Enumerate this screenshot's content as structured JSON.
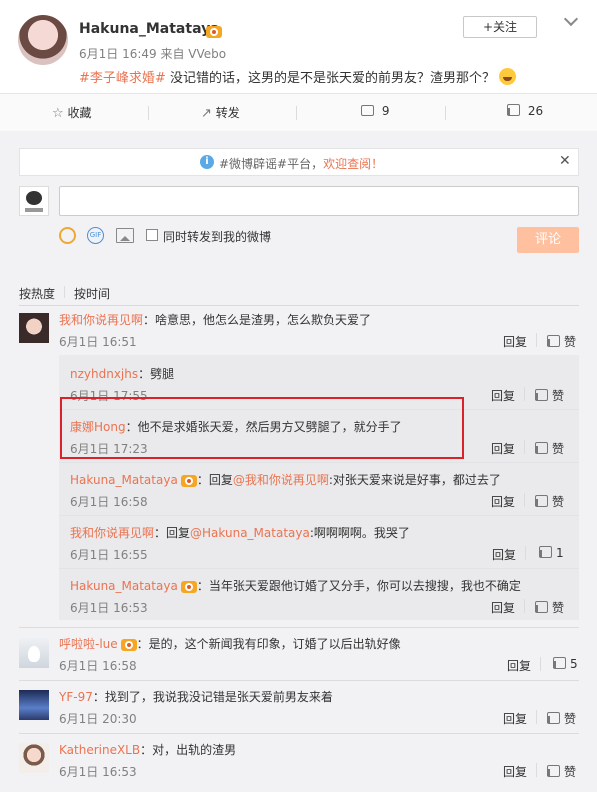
{
  "post": {
    "username": "Hakuna_Matataya",
    "follow_label": "+关注",
    "time": "6月1日 16:49 来自 VVebo",
    "hashtag": "#李子峰求婚#",
    "text": "没记错的话，这男的是不是张天爱的前男友？渣男那个？"
  },
  "actions": {
    "favorite": "收藏",
    "repost": "转发",
    "comment_count": "9",
    "like_count": "26"
  },
  "notice": {
    "text": "#微博辟谣#平台，",
    "link": "欢迎查阅！"
  },
  "composer": {
    "input_value": "",
    "sync_label": "同时转发到我的微博",
    "submit_label": "评论"
  },
  "sort": {
    "hot": "按热度",
    "time": "按时间"
  },
  "labels": {
    "reply": "回复",
    "like": "赞"
  },
  "comments": [
    {
      "user": "我和你说再见啊",
      "text": "：啥意思，他怎么是渣男，怎么欺负天爱了",
      "time": "6月1日 16:51",
      "replies": [
        {
          "user": "nzyhdnxjhs",
          "text": "：劈腿",
          "time": "6月1日 17:55"
        },
        {
          "user": "康娜Hong",
          "text": "：他不是求婚张天爱，然后男方又劈腿了，就分手了",
          "time": "6月1日 17:23"
        },
        {
          "user": "Hakuna_Matataya",
          "pre": "：回复",
          "mention": "@我和你说再见啊",
          "text": ":对张天爱来说是好事，都过去了",
          "time": "6月1日 16:58"
        },
        {
          "user": "我和你说再见啊",
          "pre": "：回复",
          "mention": "@Hakuna_Matataya",
          "text": ":啊啊啊啊。我哭了",
          "time": "6月1日 16:55",
          "likes": "1"
        },
        {
          "user": "Hakuna_Matataya",
          "text": "：当年张天爱跟他订婚了又分手，你可以去搜搜，我也不确定",
          "time": "6月1日 16:53"
        }
      ]
    },
    {
      "user": "呼啦啦-lue",
      "text": "：是的，这个新闻我有印象，订婚了以后出轨好像",
      "time": "6月1日 16:58",
      "likes": "5"
    },
    {
      "user": "YF-97",
      "text": "：找到了，我说我没记错是张天爱前男友来着",
      "time": "6月1日 20:30"
    },
    {
      "user": "KatherineXLB",
      "text": "：对，出轨的渣男",
      "time": "6月1日 16:53"
    }
  ]
}
